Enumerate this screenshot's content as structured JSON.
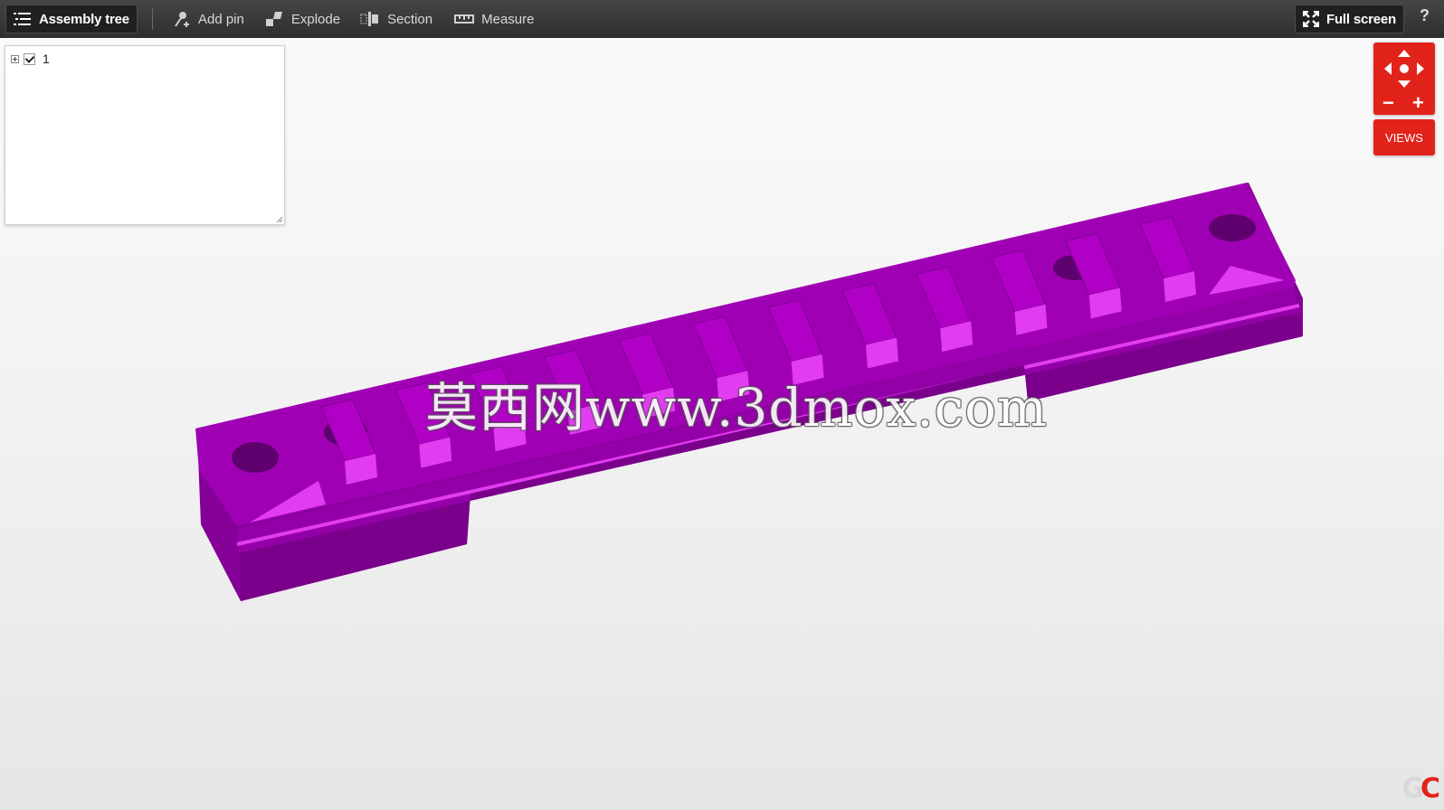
{
  "toolbar": {
    "assembly_tree_label": "Assembly tree",
    "add_pin_label": "Add pin",
    "explode_label": "Explode",
    "section_label": "Section",
    "measure_label": "Measure",
    "fullscreen_label": "Full screen",
    "help_label": "?"
  },
  "tree": {
    "items": [
      {
        "label": "1",
        "checked": true,
        "expanded": false
      }
    ]
  },
  "navigation": {
    "views_label": "VIEWS",
    "zoom_out": "−",
    "zoom_in": "+"
  },
  "viewport": {
    "watermark": "莫西网www.3dmox.com",
    "model_color": "#a000b4",
    "model_highlight": "#e23cf0"
  },
  "logo": {
    "part1": "G",
    "part2": "C"
  },
  "colors": {
    "accent": "#e2231a",
    "toolbar": "#3a3a3a"
  }
}
